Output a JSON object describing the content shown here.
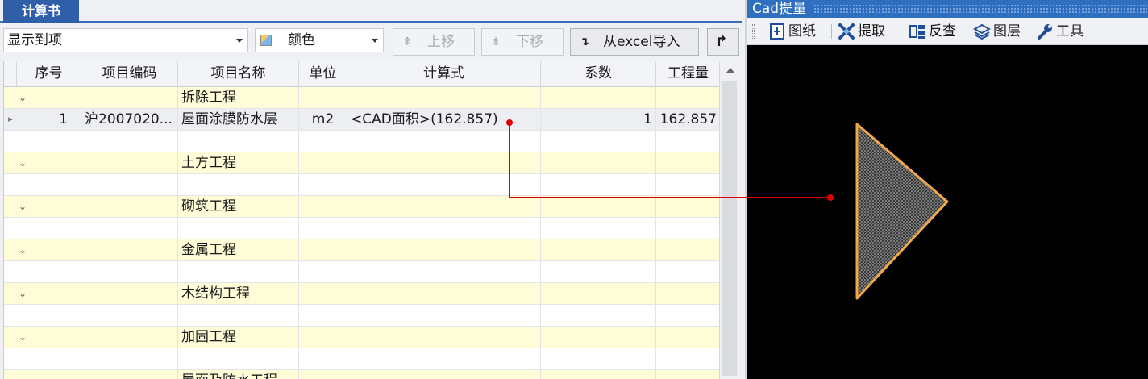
{
  "calc_panel": {
    "tab_label": "计算书",
    "display_combo": "显示到项",
    "color_combo": "颜色",
    "buttons": {
      "move_up": "上移",
      "move_down": "下移",
      "import_excel": "从excel导入"
    },
    "columns": [
      "序号",
      "项目编码",
      "项目名称",
      "单位",
      "计算式",
      "系数",
      "工程量"
    ],
    "rows": [
      {
        "type": "group",
        "name": "拆除工程"
      },
      {
        "type": "data",
        "seq": "1",
        "code": "沪2007020...",
        "name": "屋面涂膜防水层",
        "unit": "m2",
        "formula": "<CAD面积>(162.857)",
        "coef": "1",
        "qty": "162.857"
      },
      {
        "type": "blank"
      },
      {
        "type": "group",
        "name": "土方工程"
      },
      {
        "type": "blank"
      },
      {
        "type": "group",
        "name": "砌筑工程"
      },
      {
        "type": "blank"
      },
      {
        "type": "group",
        "name": "金属工程"
      },
      {
        "type": "blank"
      },
      {
        "type": "group",
        "name": "木结构工程"
      },
      {
        "type": "blank"
      },
      {
        "type": "group",
        "name": "加固工程"
      },
      {
        "type": "blank"
      },
      {
        "type": "group",
        "name": "屋面及防水工程"
      }
    ]
  },
  "cad_panel": {
    "title": "Cad提量",
    "tools": [
      {
        "label": "图纸",
        "icon": "drawing-icon"
      },
      {
        "label": "提取",
        "icon": "extract-icon"
      },
      {
        "label": "反查",
        "icon": "reverse-lookup-icon"
      },
      {
        "label": "图层",
        "icon": "layers-icon"
      },
      {
        "label": "工具",
        "icon": "wrench-icon"
      }
    ],
    "canvas_bg": "#000000",
    "shape_outline": "#f0a848",
    "shape_fill": "hatched-gray"
  },
  "link_line_color": "#e00000"
}
